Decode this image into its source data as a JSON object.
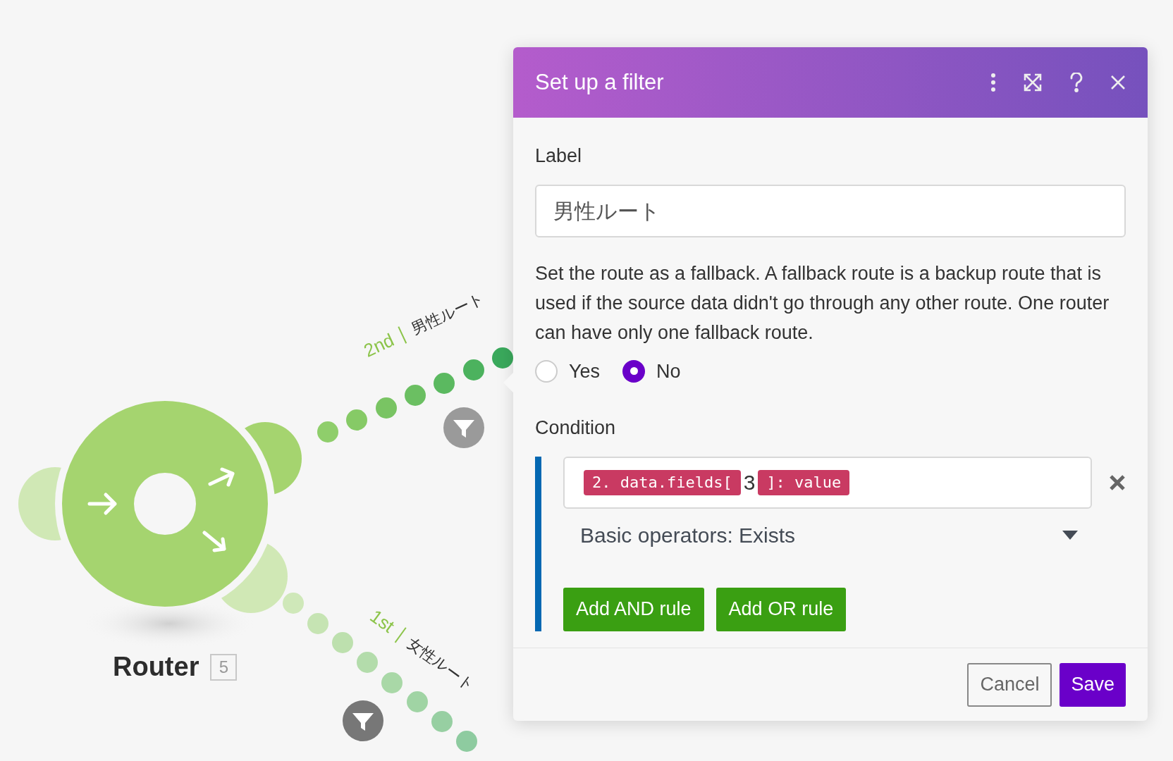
{
  "canvas": {
    "module": {
      "title": "Router",
      "badge": "5"
    },
    "routes": [
      {
        "order": "2nd",
        "label": "男性ルート"
      },
      {
        "order": "1st",
        "label": "女性ルート"
      }
    ]
  },
  "dialog": {
    "title": "Set up a filter",
    "label_field": {
      "label": "Label",
      "value": "男性ルート"
    },
    "fallback": {
      "description": "Set the route as a fallback. A fallback route is a backup route that is used if the source data didn't go through any other route. One router can have only one fallback route.",
      "options": [
        {
          "label": "Yes",
          "selected": false
        },
        {
          "label": "No",
          "selected": true
        }
      ]
    },
    "condition": {
      "label": "Condition",
      "tokens": [
        {
          "kind": "pill",
          "text": "2. data.fields["
        },
        {
          "kind": "text",
          "text": "3"
        },
        {
          "kind": "pill",
          "text": "]: value"
        }
      ],
      "operator": "Basic operators: Exists",
      "buttons": [
        "Add AND rule",
        "Add OR rule"
      ]
    },
    "footer": [
      {
        "kind": "outline",
        "label": "Cancel"
      },
      {
        "kind": "primary",
        "label": "Save"
      }
    ]
  }
}
